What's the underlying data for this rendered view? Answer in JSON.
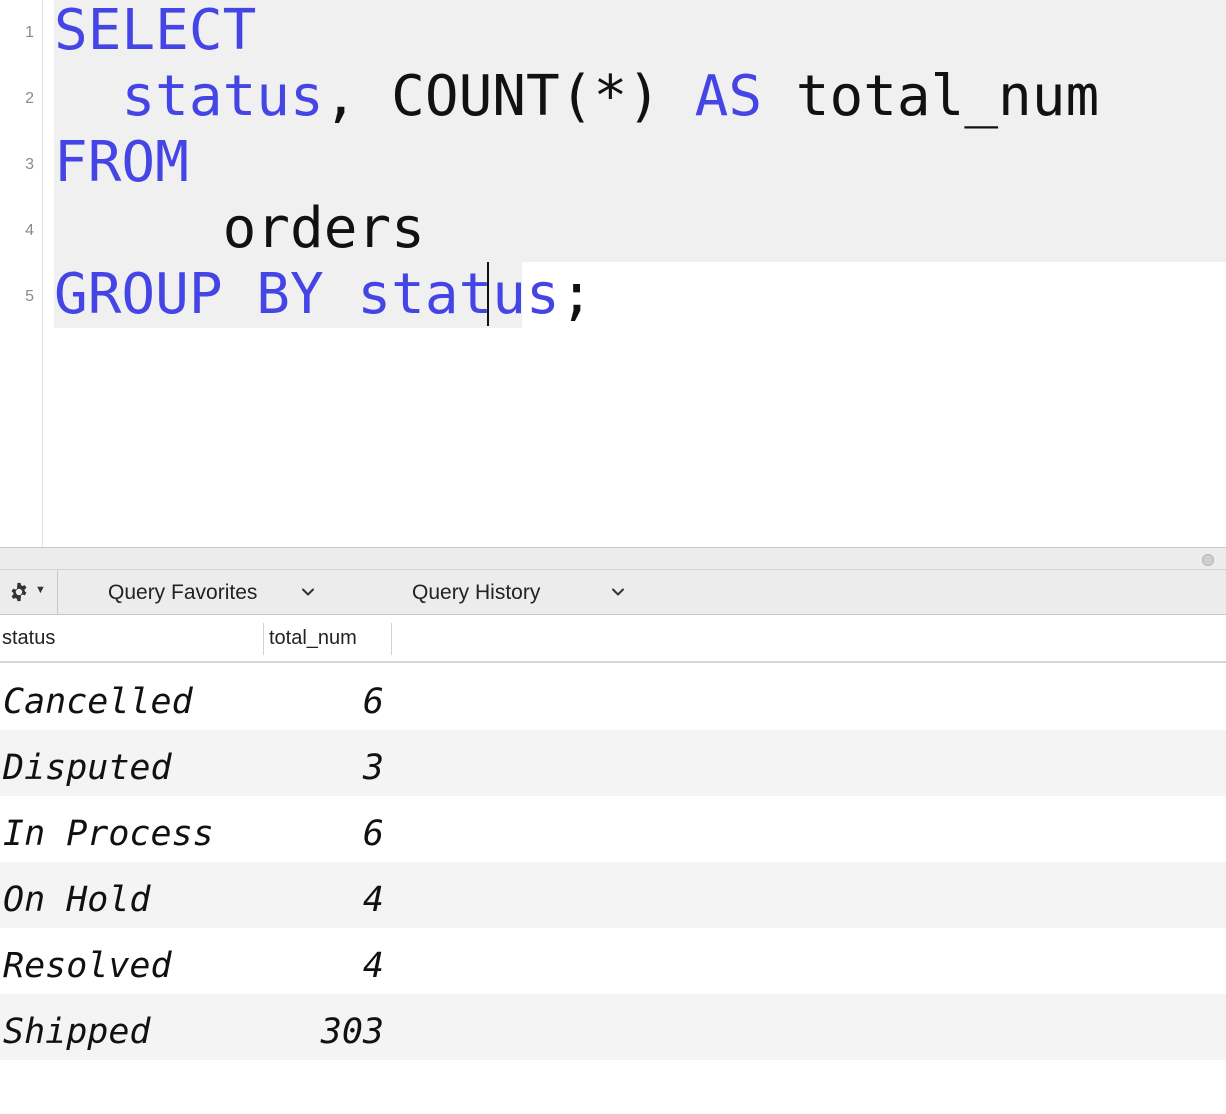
{
  "editor": {
    "line_numbers": [
      "1",
      "2",
      "3",
      "4",
      "5"
    ],
    "lines": [
      [
        {
          "t": "SELECT",
          "kw": true
        }
      ],
      [
        {
          "t": "  "
        },
        {
          "t": "status",
          "kw": true
        },
        {
          "t": ", COUNT(*) "
        },
        {
          "t": "AS",
          "kw": true
        },
        {
          "t": " total_num"
        }
      ],
      [
        {
          "t": "FROM",
          "kw": true
        }
      ],
      [
        {
          "t": "     orders"
        }
      ],
      [
        {
          "t": "GROUP BY status",
          "kw": true
        },
        {
          "t": ";"
        }
      ]
    ],
    "colors": {
      "keyword": "#4545e6",
      "text": "#111111",
      "selection": "#f0f0f0"
    }
  },
  "toolbar": {
    "gear_icon": "gear-icon",
    "favorites_label": "Query Favorites",
    "history_label": "Query History"
  },
  "results": {
    "columns": [
      "status",
      "total_num"
    ],
    "rows": [
      {
        "status": "Cancelled",
        "total_num": "6"
      },
      {
        "status": "Disputed",
        "total_num": "3"
      },
      {
        "status": "In Process",
        "total_num": "6"
      },
      {
        "status": "On Hold",
        "total_num": "4"
      },
      {
        "status": "Resolved",
        "total_num": "4"
      },
      {
        "status": "Shipped",
        "total_num": "303"
      }
    ]
  }
}
